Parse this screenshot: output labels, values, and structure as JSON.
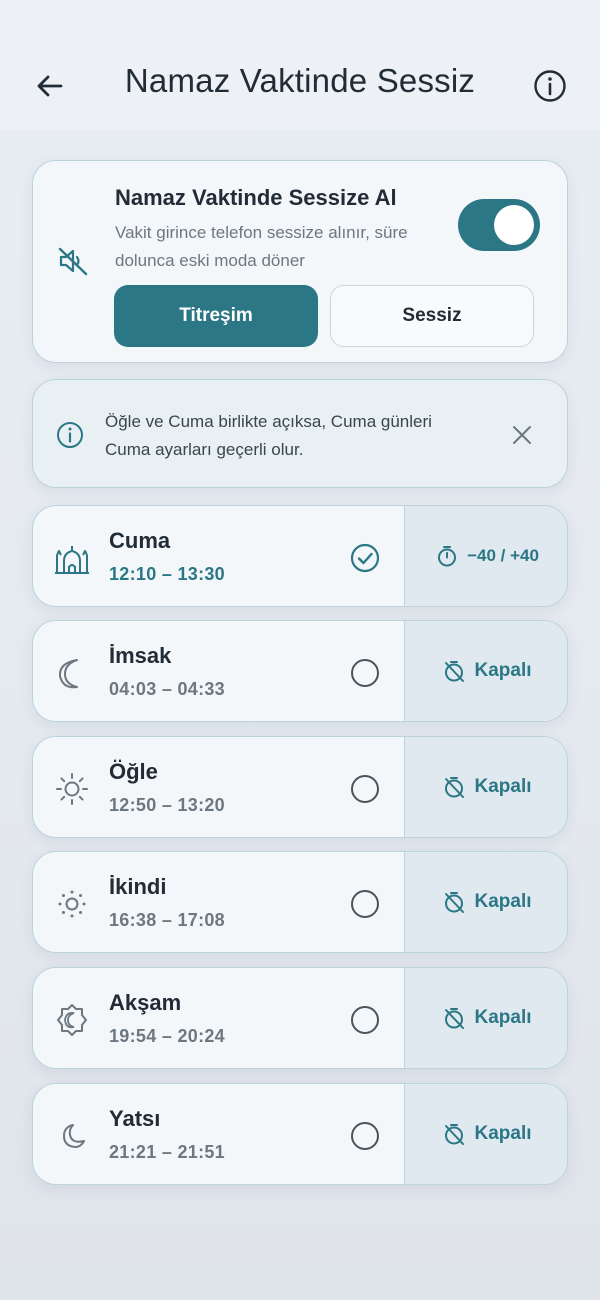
{
  "header": {
    "title": "Namaz Vaktinde Sessiz",
    "back_icon": "arrow-left-icon",
    "info_icon": "info-icon"
  },
  "silent_card": {
    "title": "Namaz Vaktinde Sessize Al",
    "subtitle": "Vakit girince telefon sessize alınır, süre dolunca eski moda döner",
    "icon": "volume-off-icon",
    "enabled": true,
    "modes": {
      "vibrate_label": "Titreşim",
      "silent_label": "Sessiz",
      "selected": "vibrate"
    }
  },
  "notice": {
    "text": "Öğle ve Cuma birlikte açıksa, Cuma günleri Cuma ayarları geçerli olur.",
    "icon": "info-icon",
    "close_icon": "close-icon"
  },
  "prayers": [
    {
      "name": "Cuma",
      "time": "12:10 – 13:30",
      "icon": "mosque-icon",
      "checked": true,
      "offset_label": "−40 / +40",
      "offset_icon": "timer-icon"
    },
    {
      "name": "İmsak",
      "time": "04:03 – 04:33",
      "icon": "crescent-moon-icon",
      "checked": false,
      "offset_label": "Kapalı",
      "offset_icon": "timer-off-icon"
    },
    {
      "name": "Öğle",
      "time": "12:50 – 13:20",
      "icon": "sun-icon",
      "checked": false,
      "offset_label": "Kapalı",
      "offset_icon": "timer-off-icon"
    },
    {
      "name": "İkindi",
      "time": "16:38 – 17:08",
      "icon": "sun-small-icon",
      "checked": false,
      "offset_label": "Kapalı",
      "offset_icon": "timer-off-icon"
    },
    {
      "name": "Akşam",
      "time": "19:54 – 20:24",
      "icon": "sunset-badge-icon",
      "checked": false,
      "offset_label": "Kapalı",
      "offset_icon": "timer-off-icon"
    },
    {
      "name": "Yatsı",
      "time": "21:21 – 21:51",
      "icon": "moon-icon",
      "checked": false,
      "offset_label": "Kapalı",
      "offset_icon": "timer-off-icon"
    }
  ],
  "colors": {
    "accent": "#2b7785",
    "text_primary": "#222c36",
    "text_secondary": "#6c7780",
    "card_border": "#bcd3da"
  }
}
